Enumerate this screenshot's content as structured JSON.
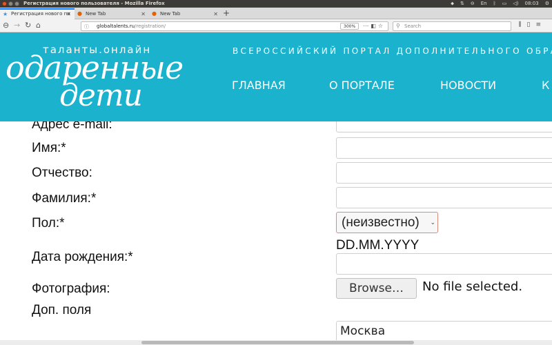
{
  "os": {
    "window_title": "Регистрация нового пользователя - Mozilla Firefox",
    "clock": "08:03",
    "keyboard_layout": "En"
  },
  "browser": {
    "tabs": [
      {
        "label": "Регистрация нового по",
        "active": true,
        "icon": "star-icon"
      },
      {
        "label": "New Tab",
        "active": false,
        "icon": "firefox-icon"
      },
      {
        "label": "New Tab",
        "active": false,
        "icon": "firefox-icon"
      }
    ],
    "url_host": "globaltalents.ru",
    "url_path": "/registration/",
    "zoom": "300%",
    "search_placeholder": "Search"
  },
  "site": {
    "logo_top": "таланты.онлайн",
    "logo_line1": "одаренные",
    "logo_line2": "дети",
    "tagline": "ВСЕРОССИЙСКИЙ ПОРТАЛ ДОПОЛНИТЕЛЬНОГО ОБРАЗОВ",
    "menu": [
      "ГЛАВНАЯ",
      "О ПОРТАЛЕ",
      "НОВОСТИ",
      "К"
    ]
  },
  "form": {
    "email_label": "Адрес e-mail:",
    "first_name_label": "Имя:*",
    "patronymic_label": "Отчество:",
    "last_name_label": "Фамилия:*",
    "gender_label": "Пол:*",
    "gender_value": "(неизвестно)",
    "birthdate_label": "Дата рождения:*",
    "birthdate_hint": "DD.MM.YYYY",
    "photo_label": "Фотография:",
    "browse_label": "Browse…",
    "file_status": "No file selected.",
    "extra_fields_label": "Доп. поля",
    "city_value": "Москва"
  },
  "colors": {
    "header_bg": "#1ab2cc",
    "active_tab_accent": "#0a84ff"
  }
}
